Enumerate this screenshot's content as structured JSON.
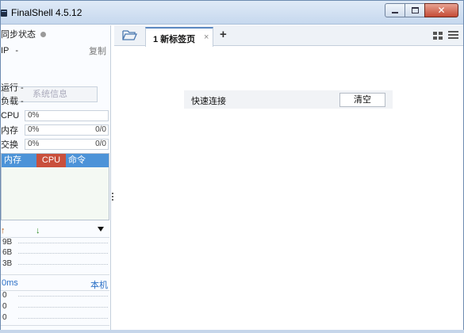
{
  "window": {
    "title": "FinalShell 4.5.12"
  },
  "sidebar": {
    "sync_status": "同步状态",
    "ip_label": "IP",
    "ip_value": "-",
    "copy": "复制",
    "sysinfo_button": "系统信息",
    "uptime": "运行 -",
    "load": "负载 -",
    "cpu": {
      "label": "CPU",
      "value": "0%"
    },
    "mem": {
      "label": "内存",
      "value": "0%",
      "ratio": "0/0"
    },
    "swap": {
      "label": "交换",
      "value": "0%",
      "ratio": "0/0"
    },
    "proc_tabs": [
      "内存",
      "CPU",
      "命令"
    ],
    "net": {
      "rows": [
        "9B",
        "6B",
        "3B"
      ]
    },
    "ping": {
      "ms": "0ms",
      "host": "本机",
      "rows": [
        "0",
        "0",
        "0"
      ]
    }
  },
  "tabs": {
    "items": [
      {
        "label": "1 新标签页",
        "close": "×"
      }
    ],
    "add": "+"
  },
  "main": {
    "quick_connect_label": "快速连接",
    "clear_button": "清空"
  }
}
